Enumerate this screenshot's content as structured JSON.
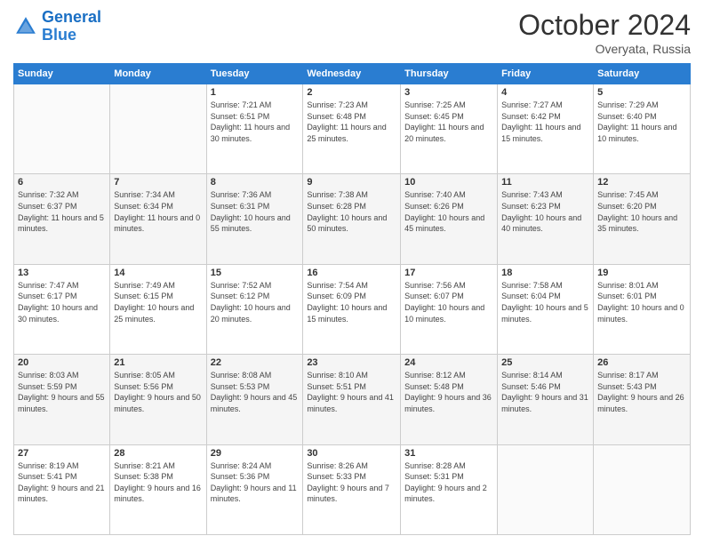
{
  "header": {
    "logo_general": "General",
    "logo_blue": "Blue",
    "month_title": "October 2024",
    "location": "Overyata, Russia"
  },
  "days_of_week": [
    "Sunday",
    "Monday",
    "Tuesday",
    "Wednesday",
    "Thursday",
    "Friday",
    "Saturday"
  ],
  "weeks": [
    [
      {
        "day": "",
        "info": ""
      },
      {
        "day": "",
        "info": ""
      },
      {
        "day": "1",
        "info": "Sunrise: 7:21 AM\nSunset: 6:51 PM\nDaylight: 11 hours and 30 minutes."
      },
      {
        "day": "2",
        "info": "Sunrise: 7:23 AM\nSunset: 6:48 PM\nDaylight: 11 hours and 25 minutes."
      },
      {
        "day": "3",
        "info": "Sunrise: 7:25 AM\nSunset: 6:45 PM\nDaylight: 11 hours and 20 minutes."
      },
      {
        "day": "4",
        "info": "Sunrise: 7:27 AM\nSunset: 6:42 PM\nDaylight: 11 hours and 15 minutes."
      },
      {
        "day": "5",
        "info": "Sunrise: 7:29 AM\nSunset: 6:40 PM\nDaylight: 11 hours and 10 minutes."
      }
    ],
    [
      {
        "day": "6",
        "info": "Sunrise: 7:32 AM\nSunset: 6:37 PM\nDaylight: 11 hours and 5 minutes."
      },
      {
        "day": "7",
        "info": "Sunrise: 7:34 AM\nSunset: 6:34 PM\nDaylight: 11 hours and 0 minutes."
      },
      {
        "day": "8",
        "info": "Sunrise: 7:36 AM\nSunset: 6:31 PM\nDaylight: 10 hours and 55 minutes."
      },
      {
        "day": "9",
        "info": "Sunrise: 7:38 AM\nSunset: 6:28 PM\nDaylight: 10 hours and 50 minutes."
      },
      {
        "day": "10",
        "info": "Sunrise: 7:40 AM\nSunset: 6:26 PM\nDaylight: 10 hours and 45 minutes."
      },
      {
        "day": "11",
        "info": "Sunrise: 7:43 AM\nSunset: 6:23 PM\nDaylight: 10 hours and 40 minutes."
      },
      {
        "day": "12",
        "info": "Sunrise: 7:45 AM\nSunset: 6:20 PM\nDaylight: 10 hours and 35 minutes."
      }
    ],
    [
      {
        "day": "13",
        "info": "Sunrise: 7:47 AM\nSunset: 6:17 PM\nDaylight: 10 hours and 30 minutes."
      },
      {
        "day": "14",
        "info": "Sunrise: 7:49 AM\nSunset: 6:15 PM\nDaylight: 10 hours and 25 minutes."
      },
      {
        "day": "15",
        "info": "Sunrise: 7:52 AM\nSunset: 6:12 PM\nDaylight: 10 hours and 20 minutes."
      },
      {
        "day": "16",
        "info": "Sunrise: 7:54 AM\nSunset: 6:09 PM\nDaylight: 10 hours and 15 minutes."
      },
      {
        "day": "17",
        "info": "Sunrise: 7:56 AM\nSunset: 6:07 PM\nDaylight: 10 hours and 10 minutes."
      },
      {
        "day": "18",
        "info": "Sunrise: 7:58 AM\nSunset: 6:04 PM\nDaylight: 10 hours and 5 minutes."
      },
      {
        "day": "19",
        "info": "Sunrise: 8:01 AM\nSunset: 6:01 PM\nDaylight: 10 hours and 0 minutes."
      }
    ],
    [
      {
        "day": "20",
        "info": "Sunrise: 8:03 AM\nSunset: 5:59 PM\nDaylight: 9 hours and 55 minutes."
      },
      {
        "day": "21",
        "info": "Sunrise: 8:05 AM\nSunset: 5:56 PM\nDaylight: 9 hours and 50 minutes."
      },
      {
        "day": "22",
        "info": "Sunrise: 8:08 AM\nSunset: 5:53 PM\nDaylight: 9 hours and 45 minutes."
      },
      {
        "day": "23",
        "info": "Sunrise: 8:10 AM\nSunset: 5:51 PM\nDaylight: 9 hours and 41 minutes."
      },
      {
        "day": "24",
        "info": "Sunrise: 8:12 AM\nSunset: 5:48 PM\nDaylight: 9 hours and 36 minutes."
      },
      {
        "day": "25",
        "info": "Sunrise: 8:14 AM\nSunset: 5:46 PM\nDaylight: 9 hours and 31 minutes."
      },
      {
        "day": "26",
        "info": "Sunrise: 8:17 AM\nSunset: 5:43 PM\nDaylight: 9 hours and 26 minutes."
      }
    ],
    [
      {
        "day": "27",
        "info": "Sunrise: 8:19 AM\nSunset: 5:41 PM\nDaylight: 9 hours and 21 minutes."
      },
      {
        "day": "28",
        "info": "Sunrise: 8:21 AM\nSunset: 5:38 PM\nDaylight: 9 hours and 16 minutes."
      },
      {
        "day": "29",
        "info": "Sunrise: 8:24 AM\nSunset: 5:36 PM\nDaylight: 9 hours and 11 minutes."
      },
      {
        "day": "30",
        "info": "Sunrise: 8:26 AM\nSunset: 5:33 PM\nDaylight: 9 hours and 7 minutes."
      },
      {
        "day": "31",
        "info": "Sunrise: 8:28 AM\nSunset: 5:31 PM\nDaylight: 9 hours and 2 minutes."
      },
      {
        "day": "",
        "info": ""
      },
      {
        "day": "",
        "info": ""
      }
    ]
  ]
}
